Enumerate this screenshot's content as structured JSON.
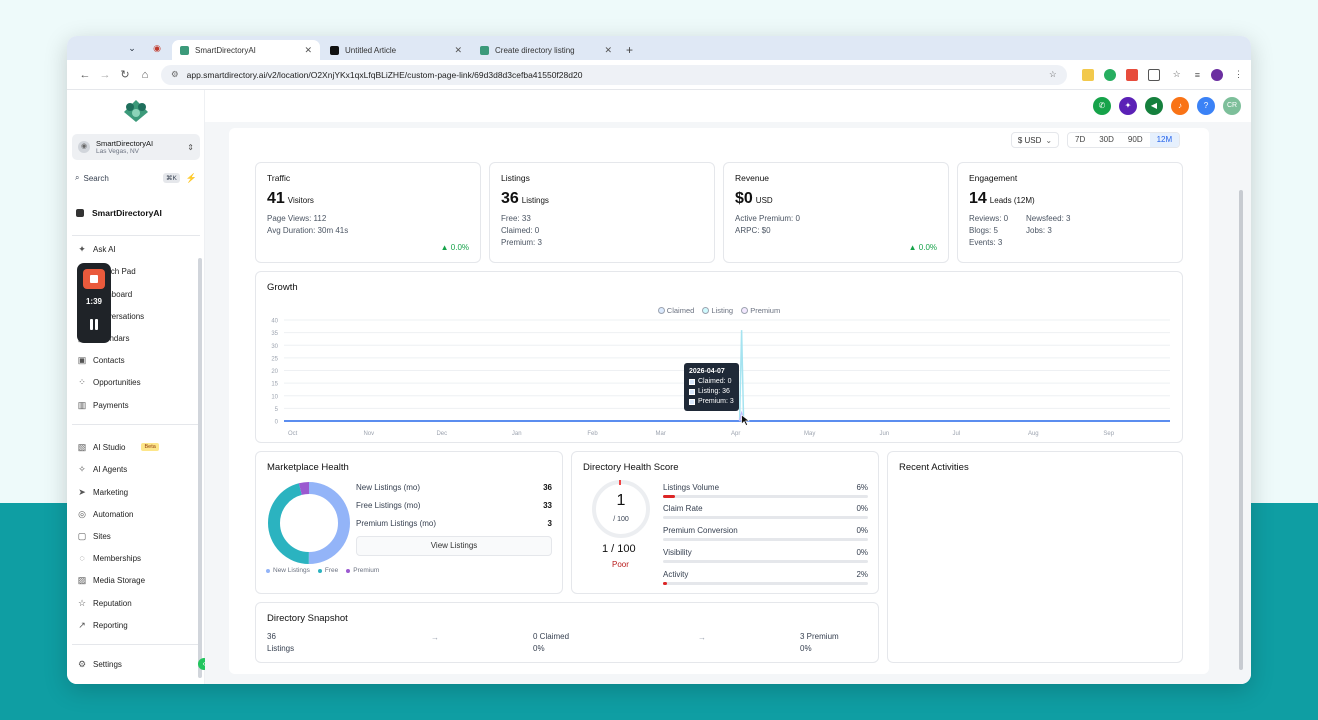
{
  "browser": {
    "tabs": [
      {
        "title": "SmartDirectoryAI",
        "active": true
      },
      {
        "title": "Untitled Article",
        "active": false
      },
      {
        "title": "Create directory listing",
        "active": false
      }
    ],
    "url": "app.smartdirectory.ai/v2/location/O2XnjYKx1qxLfqBLiZHE/custom-page-link/69d3d8d3cefba41550f28d20"
  },
  "sidebar": {
    "location_name": "SmartDirectoryAI",
    "location_sub": "Las Vegas, NV",
    "search_label": "Search",
    "search_shortcut": "⌘K",
    "account_label": "SmartDirectoryAI",
    "items": [
      {
        "label": "Ask AI",
        "icon": "sparkle-icon"
      },
      {
        "label": "Launch Pad",
        "icon": "rocket-icon"
      },
      {
        "label": "Dashboard",
        "icon": "dashboard-icon"
      },
      {
        "label": "Conversations",
        "icon": "chat-icon"
      },
      {
        "label": "Calendars",
        "icon": "calendar-icon"
      },
      {
        "label": "Contacts",
        "icon": "contacts-icon"
      },
      {
        "label": "Opportunities",
        "icon": "opportunities-icon"
      },
      {
        "label": "Payments",
        "icon": "payments-icon"
      },
      {
        "label": "AI Studio",
        "icon": "ai-studio-icon",
        "badge": "Beta"
      },
      {
        "label": "AI Agents",
        "icon": "ai-agents-icon"
      },
      {
        "label": "Marketing",
        "icon": "send-icon"
      },
      {
        "label": "Automation",
        "icon": "automation-icon"
      },
      {
        "label": "Sites",
        "icon": "sites-icon"
      },
      {
        "label": "Memberships",
        "icon": "memberships-icon"
      },
      {
        "label": "Media Storage",
        "icon": "media-icon"
      },
      {
        "label": "Reputation",
        "icon": "star-icon"
      },
      {
        "label": "Reporting",
        "icon": "reporting-icon"
      }
    ],
    "settings_label": "Settings"
  },
  "recorder": {
    "time": "1:39"
  },
  "header": {
    "avatar_initials": "CR"
  },
  "filters": {
    "currency": "$ USD",
    "ranges": [
      "7D",
      "30D",
      "90D",
      "12M"
    ],
    "selected_range": "12M"
  },
  "kpis": {
    "traffic": {
      "title": "Traffic",
      "value": "41",
      "unit": "Visitors",
      "lines": [
        "Page Views: 112",
        "Avg Duration: 30m 41s"
      ],
      "delta": "▲ 0.0%"
    },
    "listings": {
      "title": "Listings",
      "value": "36",
      "unit": "Listings",
      "lines": [
        "Free: 33",
        "Claimed: 0",
        "Premium: 3"
      ]
    },
    "revenue": {
      "title": "Revenue",
      "value": "$0",
      "unit": "USD",
      "lines": [
        "Active Premium: 0",
        "ARPC: $0"
      ],
      "delta": "▲ 0.0%"
    },
    "engagement": {
      "title": "Engagement",
      "value": "14",
      "unit": "Leads (12M)",
      "lines_left": [
        "Reviews: 0",
        "Blogs: 5",
        "Events: 3"
      ],
      "lines_right": [
        "Newsfeed: 3",
        "Jobs: 3"
      ]
    }
  },
  "growth": {
    "title": "Growth",
    "tooltip": {
      "date": "2026-04-07",
      "rows": [
        "Claimed: 0",
        "Listing: 36",
        "Premium: 3"
      ]
    }
  },
  "chart_data": {
    "type": "line",
    "title": "",
    "legend": [
      "Claimed",
      "Listing",
      "Premium"
    ],
    "legend_position": "top-center",
    "x_ticks": [
      "Oct",
      "Nov",
      "Dec",
      "Jan",
      "Feb",
      "Mar",
      "Apr",
      "May",
      "Jun",
      "Jul",
      "Aug",
      "Sep"
    ],
    "y_ticks": [
      0,
      5,
      10,
      15,
      20,
      25,
      30,
      35,
      40
    ],
    "ylim": [
      0,
      40
    ],
    "grid": true,
    "series": [
      {
        "name": "Claimed",
        "points": [
          {
            "x": "2026-04-07",
            "y": 0
          }
        ],
        "baseline": 0
      },
      {
        "name": "Listing",
        "points": [
          {
            "x": "2026-04-07",
            "y": 36
          }
        ],
        "baseline": 0
      },
      {
        "name": "Premium",
        "points": [
          {
            "x": "2026-04-07",
            "y": 3
          }
        ],
        "baseline": 0
      }
    ]
  },
  "marketplace": {
    "title": "Marketplace Health",
    "rows": [
      {
        "label": "New Listings (mo)",
        "value": "36"
      },
      {
        "label": "Free Listings (mo)",
        "value": "33"
      },
      {
        "label": "Premium Listings (mo)",
        "value": "3"
      }
    ],
    "button": "View Listings",
    "legend": [
      "New Listings",
      "Free",
      "Premium"
    ],
    "donut": [
      {
        "name": "New Listings",
        "value": 36,
        "color": "#93b4f8"
      },
      {
        "name": "Free",
        "value": 33,
        "color": "#2bb3c0"
      },
      {
        "name": "Premium",
        "value": 3,
        "color": "#9b59d0"
      }
    ]
  },
  "health": {
    "title": "Directory Health Score",
    "score": "1",
    "score_of": "/ 100",
    "score_text": "1 / 100",
    "label": "Poor",
    "metrics": [
      {
        "label": "Listings Volume",
        "pct": "6%",
        "value": 6
      },
      {
        "label": "Claim Rate",
        "pct": "0%",
        "value": 0
      },
      {
        "label": "Premium Conversion",
        "pct": "0%",
        "value": 0
      },
      {
        "label": "Visibility",
        "pct": "0%",
        "value": 0
      },
      {
        "label": "Activity",
        "pct": "2%",
        "value": 2
      }
    ]
  },
  "recent": {
    "title": "Recent Activities"
  },
  "snapshot": {
    "title": "Directory Snapshot",
    "cols": [
      {
        "top": "36",
        "bottom": "Listings"
      },
      {
        "top": "0 Claimed",
        "bottom": "0%"
      },
      {
        "top": "3 Premium",
        "bottom": "0%"
      }
    ]
  }
}
